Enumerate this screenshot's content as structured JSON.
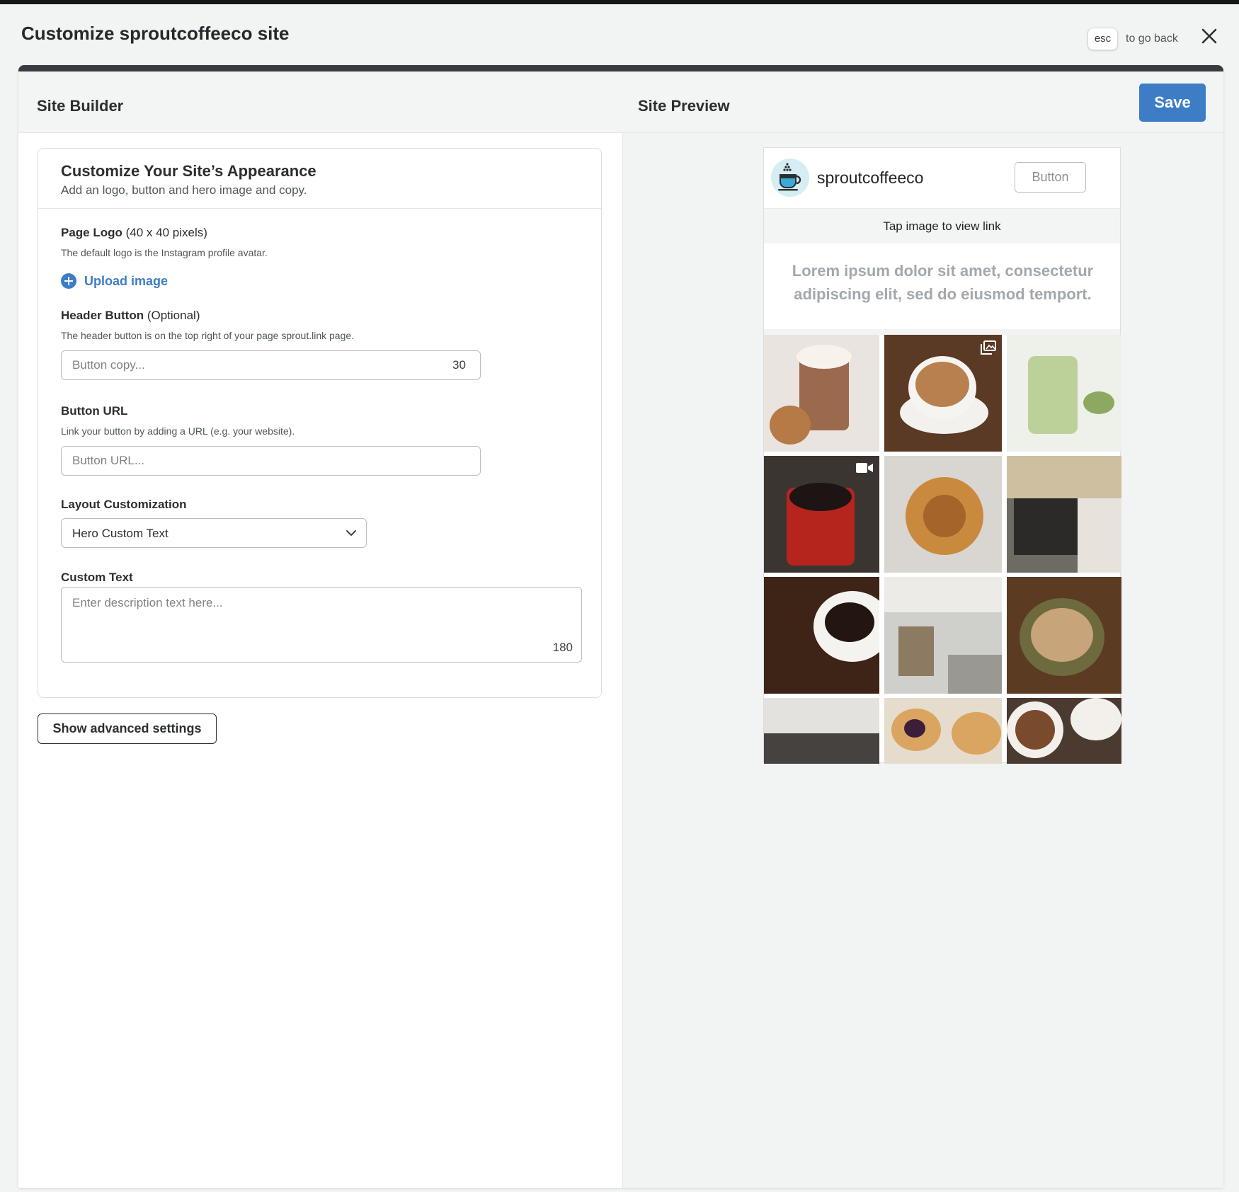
{
  "modal": {
    "title": "Customize sproutcoffeeco site",
    "esc_key": "esc",
    "esc_hint": "to go back"
  },
  "panels": {
    "builder_title": "Site Builder",
    "preview_title": "Site Preview",
    "save_label": "Save"
  },
  "appearance": {
    "title": "Customize Your Site’s Appearance",
    "subtitle": "Add an logo, button and hero image and copy.",
    "page_logo": {
      "label": "Page Logo",
      "label_suffix": " (40 x 40 pixels)",
      "help": "The default logo is the Instagram profile avatar.",
      "upload_label": "Upload image"
    },
    "header_button": {
      "label": "Header Button",
      "label_suffix": " (Optional)",
      "help": "The header button is on the top right of your page sprout.link page.",
      "placeholder": "Button copy...",
      "value": "",
      "char_count": "30"
    },
    "button_url": {
      "label": "Button URL",
      "help": "Link your button by adding a URL (e.g. your website).",
      "placeholder": "Button URL...",
      "value": ""
    },
    "layout": {
      "label": "Layout Customization",
      "selected": "Hero Custom Text"
    },
    "custom_text": {
      "label": "Custom Text",
      "placeholder": "Enter description text here...",
      "value": "",
      "char_count": "180"
    },
    "advanced_label": "Show advanced settings"
  },
  "preview": {
    "profile_name": "sproutcoffeeco",
    "header_button_label": "Button",
    "tap_hint": "Tap image to view link",
    "hero_text": "Lorem ipsum dolor sit amet, consectetur adipiscing elit, sed do eiusmod temport.",
    "tiles": [
      {
        "subject": "hot chocolate with whipped cream and gingerbread cookies",
        "badge": ""
      },
      {
        "subject": "latte art cappuccino",
        "badge": "gallery-icon"
      },
      {
        "subject": "matcha latte",
        "badge": ""
      },
      {
        "subject": "red mug of black coffee",
        "badge": "video-icon"
      },
      {
        "subject": "cinnamon knot pastry on cooling rack",
        "badge": ""
      },
      {
        "subject": "cafe interior with counter",
        "badge": ""
      },
      {
        "subject": "coffee beans and cup of black coffee",
        "badge": ""
      },
      {
        "subject": "bright cafe interior with shelves",
        "badge": ""
      },
      {
        "subject": "green cup of coffee with spoon",
        "badge": ""
      },
      {
        "subject": "cafe seating with benches",
        "badge": ""
      },
      {
        "subject": "berry danish pastries",
        "badge": ""
      },
      {
        "subject": "bowls of ground coffee and beans",
        "badge": ""
      }
    ]
  },
  "colors": {
    "accent": "#3d7dc6",
    "background": "#f2f3f3",
    "text": "#2b2f32"
  }
}
